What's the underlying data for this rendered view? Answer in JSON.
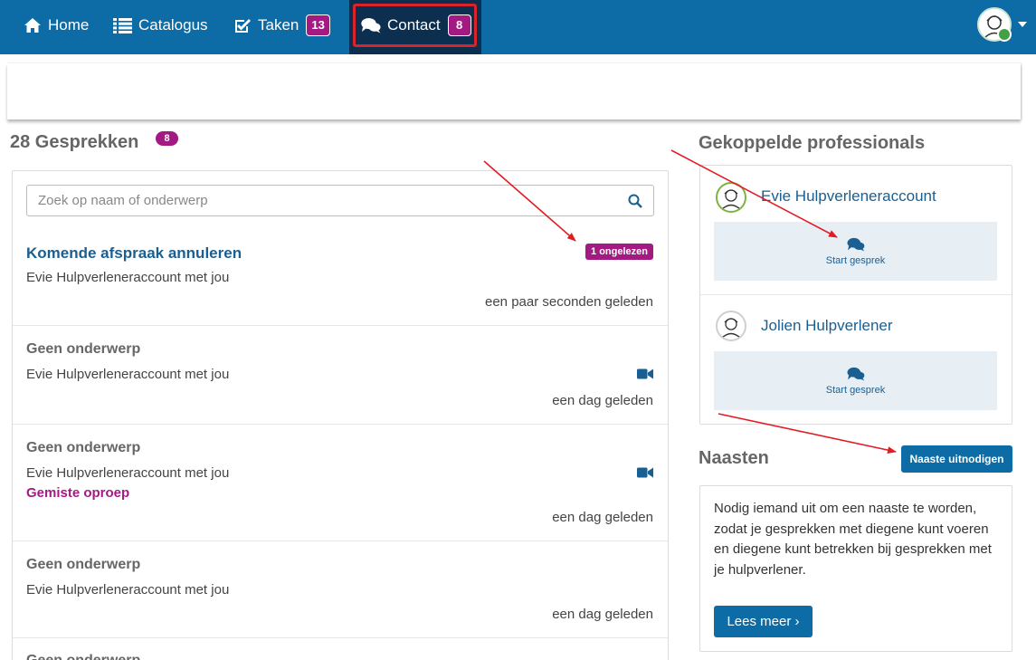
{
  "nav": {
    "home_label": "Home",
    "catalogus_label": "Catalogus",
    "taken_label": "Taken",
    "taken_count": "13",
    "contact_label": "Contact",
    "contact_count": "8"
  },
  "conversations": {
    "heading": "28 Gesprekken",
    "unread_total": "8",
    "search_placeholder": "Zoek op naam of onderwerp",
    "items": [
      {
        "title": "Komende afspraak annuleren",
        "participants": "Evie Hulpverleneraccount met jou",
        "badge": "1 ongelezen",
        "time": "een paar seconden geleden"
      },
      {
        "title": "Geen onderwerp",
        "participants": "Evie Hulpverleneraccount met jou",
        "time": "een dag geleden",
        "icon": "video-camera-icon"
      },
      {
        "title": "Geen onderwerp",
        "participants": "Evie Hulpverleneraccount met jou",
        "status": "Gemiste oproep",
        "time": "een dag geleden",
        "icon": "video-camera-icon"
      },
      {
        "title": "Geen onderwerp",
        "participants": "Evie Hulpverleneraccount met jou",
        "time": "een dag geleden"
      },
      {
        "title": "Geen onderwerp"
      }
    ]
  },
  "professionals": {
    "heading": "Gekoppelde professionals",
    "items": [
      {
        "name": "Evie Hulpverleneraccount",
        "action": "Start gesprek"
      },
      {
        "name": "Jolien Hulpverlener",
        "action": "Start gesprek"
      }
    ]
  },
  "naasten": {
    "heading": "Naasten",
    "invite_label": "Naaste uitnodigen",
    "description": "Nodig iemand uit om een naaste te worden, zodat je gesprekken met diegene kunt voeren en diegene kunt betrekken bij gesprekken met je hulpverlener.",
    "read_more_label": "Lees meer ›"
  },
  "colors": {
    "nav_bg": "#0d6ba6",
    "nav_active_bg": "#0c2f4f",
    "badge": "#a31a82",
    "link": "#1a5f91",
    "highlight": "#d9242b"
  }
}
